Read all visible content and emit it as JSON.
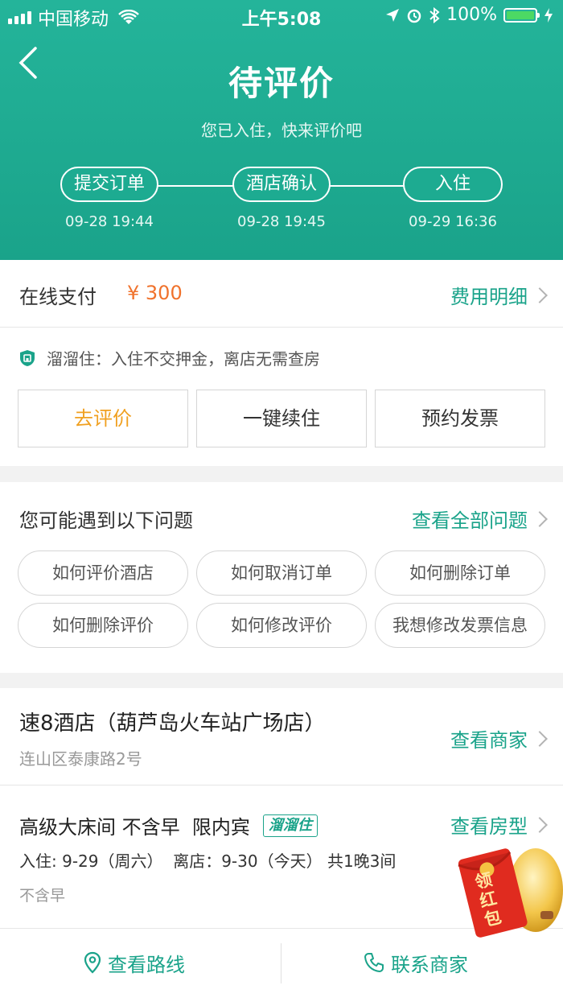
{
  "status_bar": {
    "carrier": "中国移动",
    "time": "上午5:08",
    "battery": "100%"
  },
  "header": {
    "title": "待评价",
    "subtitle": "您已入住，快来评价吧",
    "steps": [
      {
        "label": "提交订单",
        "time": "09-28 19:44"
      },
      {
        "label": "酒店确认",
        "time": "09-28 19:45"
      },
      {
        "label": "入住",
        "time": "09-29 16:36"
      }
    ]
  },
  "payment": {
    "label": "在线支付",
    "amount": "¥ 300",
    "detail_link": "费用明细"
  },
  "notice": {
    "text": "溜溜住：入住不交押金，离店无需查房"
  },
  "actions": {
    "review": "去评价",
    "extend": "一键续住",
    "invoice": "预约发票"
  },
  "faq": {
    "title": "您可能遇到以下问题",
    "all_link": "查看全部问题",
    "items": [
      "如何评价酒店",
      "如何取消订单",
      "如何删除订单",
      "如何删除评价",
      "如何修改评价",
      "我想修改发票信息"
    ]
  },
  "hotel": {
    "name": "速8酒店（葫芦岛火车站广场店）",
    "address": "连山区泰康路2号",
    "view_link": "查看商家"
  },
  "room": {
    "name": "高级大床间 不含早  限内宾",
    "badge": "溜溜住",
    "view_link": "查看房型",
    "stay": "入住: 9-29（周六）  离店：9-30（今天） 共1晚3间",
    "breakfast": "不含早"
  },
  "bottom": {
    "route": "查看路线",
    "contact": "联系商家"
  },
  "red_packet": {
    "text": "领红包"
  },
  "colors": {
    "brand": "#1aa38a",
    "price": "#f0722c",
    "review_button": "#f0a020"
  }
}
